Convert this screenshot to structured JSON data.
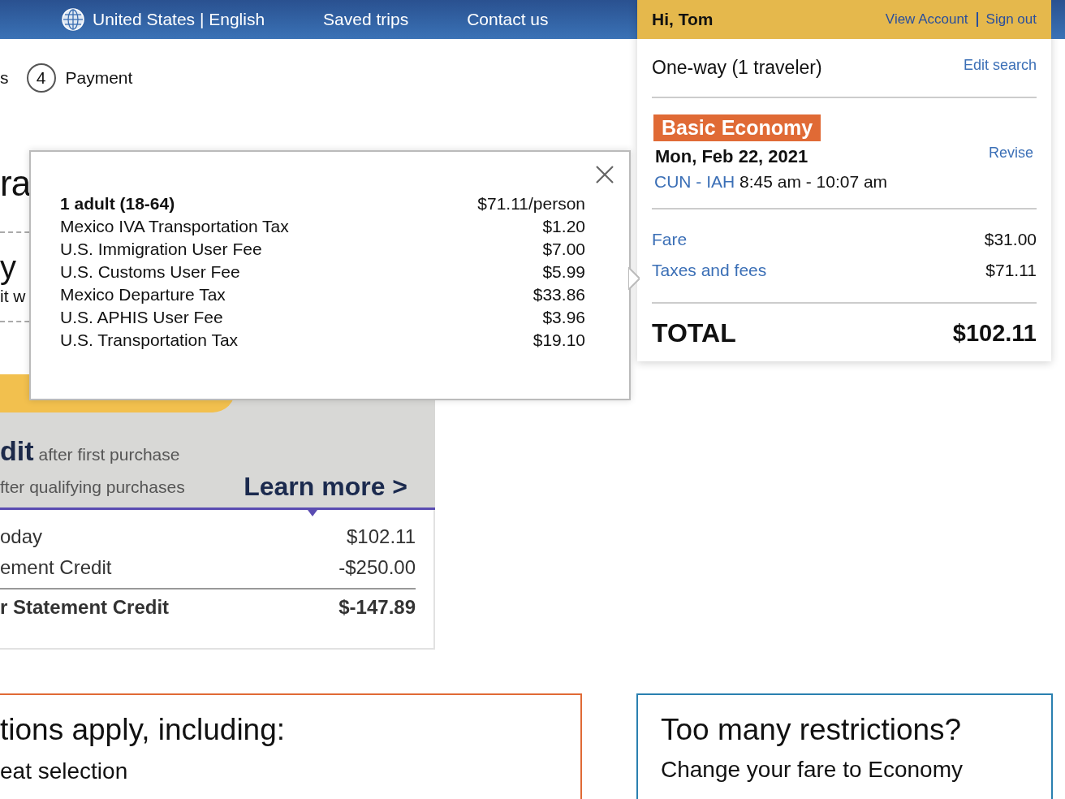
{
  "top_nav": {
    "locale": "United States | English",
    "links": [
      "Saved trips",
      "Contact us"
    ]
  },
  "account": {
    "greeting": "Hi, Tom",
    "links": [
      "View Account",
      "Sign out"
    ]
  },
  "stepper": {
    "previous_fragment": "s",
    "step_number": "4",
    "step_label": "Payment"
  },
  "main": {
    "heading_fragment": "ra",
    "subheading_fragment": "y",
    "text_fragment": "it w"
  },
  "ad_banner": {
    "line_1": "dit",
    "line_1_small": "after first purchase",
    "line_2": "fter qualifying purchases",
    "cta": "Learn more >"
  },
  "credit_table": {
    "rows": [
      {
        "label": "oday",
        "value": "$102.11",
        "kind": "normal"
      },
      {
        "label": "ement Credit",
        "value": "-$250.00",
        "kind": "normal"
      },
      {
        "label": "r Statement Credit",
        "value": "$-147.89",
        "kind": "total"
      }
    ]
  },
  "popover": {
    "header": {
      "label": "1 adult (18-64)",
      "value": "$71.11/person"
    },
    "rows": [
      {
        "label": "Mexico IVA Transportation Tax",
        "value": "$1.20"
      },
      {
        "label": "U.S. Immigration User Fee",
        "value": "$7.00"
      },
      {
        "label": "U.S. Customs User Fee",
        "value": "$5.99"
      },
      {
        "label": "Mexico Departure Tax",
        "value": "$33.86"
      },
      {
        "label": "U.S. APHIS User Fee",
        "value": "$3.96"
      },
      {
        "label": "U.S. Transportation Tax",
        "value": "$19.10"
      }
    ]
  },
  "summary": {
    "trip": "One-way (1 traveler)",
    "edit_link": "Edit search",
    "fare_class": "Basic Economy",
    "date": "Mon, Feb 22, 2021",
    "route": "CUN - IAH",
    "times": "8:45 am - 10:07 am",
    "revise_link": "Revise",
    "lines": [
      {
        "label": "Fare",
        "value": "$31.00"
      },
      {
        "label": "Taxes and fees",
        "value": "$71.11"
      }
    ],
    "total_label": "TOTAL",
    "total_value": "$102.11"
  },
  "restrictions_box": {
    "title": "tions apply, including:",
    "item": "eat selection"
  },
  "upsell_box": {
    "title": "Too many restrictions?",
    "text": "Change your fare to Economy"
  }
}
